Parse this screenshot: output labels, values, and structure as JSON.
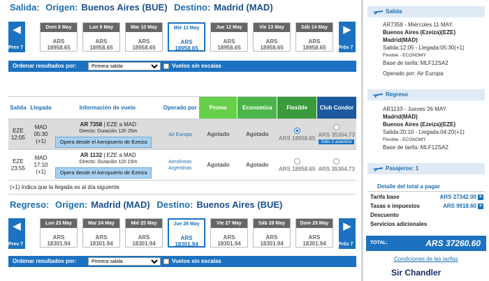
{
  "outbound": {
    "label": "Salida:",
    "origin_label": "Origen:",
    "origin": "Buenos Aires (BUE)",
    "dest_label": "Destino:",
    "dest": "Madrid (MAD)",
    "prev": "Prev 7",
    "next": "Próx 7",
    "days": [
      {
        "date": "Dom 8 May",
        "price": "ARS 18958.65"
      },
      {
        "date": "Lun 9 May",
        "price": "ARS 18958.65"
      },
      {
        "date": "Mar 10 May",
        "price": "ARS 18958.65"
      },
      {
        "date": "Mié 11 May",
        "price": "ARS 18958.65"
      },
      {
        "date": "Jue 12 May",
        "price": "ARS 18958.65"
      },
      {
        "date": "Vie 13 May",
        "price": "ARS 18958.65"
      },
      {
        "date": "Sáb 14 May",
        "price": "ARS 18958.65"
      }
    ],
    "order_label": "Ordenar resultados por:",
    "order_value": "Primera salida",
    "nonstop_label": "Vuelos sin escalas"
  },
  "table": {
    "headers": {
      "salida": "Salida",
      "llegada": "Llegada",
      "info": "Información de vuelo",
      "operado": "Operado por",
      "promo": "Promo",
      "economica": "Economica",
      "flexible": "Flexible",
      "club": "Club Condor"
    },
    "rows": [
      {
        "dep_code": "EZE",
        "dep_time": "12:05",
        "arr_code": "MAD",
        "arr_time": "05:30",
        "arr_next": "(+1)",
        "flight": "AR 7358",
        "route": "| EZE a MAD",
        "duration": "Directo: Duración 12h 25m",
        "note": "Opera desde el Aeropuerto de Ezeiza",
        "operator": "Air Europa",
        "promo": "Agotado",
        "econ": "Agotado",
        "flex": "ARS 18958.65",
        "club": "ARS 35304.73",
        "seats": "Sólo 2 asientos"
      },
      {
        "dep_code": "EZE",
        "dep_time": "23:55",
        "arr_code": "MAD",
        "arr_time": "17:10",
        "arr_next": "(+1)",
        "flight": "AR 1132",
        "route": "| EZE a MAD",
        "duration": "Directo: Duración 11h 15m",
        "note": "Opera desde el Aeropuerto de Ezeiza",
        "operator_1": "Aerolineas",
        "operator_2": "Argentinas",
        "promo": "Agotado",
        "econ": "Agotado",
        "flex": "ARS 18958.65",
        "club": "ARS 35304.73"
      }
    ],
    "footnote_mark": "(+1)",
    "footnote": "Indica que la llegada es al día siguiente"
  },
  "inbound": {
    "label": "Regreso:",
    "origin_label": "Origen:",
    "origin": "Madrid (MAD)",
    "dest_label": "Destino:",
    "dest": "Buenos Aires (BUE)",
    "prev": "Prev 7",
    "next": "Próx 7",
    "days": [
      {
        "date": "Lun 23 May",
        "price": "ARS 18301.94"
      },
      {
        "date": "Mar 24 May",
        "price": "ARS 18301.94"
      },
      {
        "date": "Mié 25 May",
        "price": "ARS 18301.94"
      },
      {
        "date": "Jue 26 May",
        "price": "ARS 18301.94"
      },
      {
        "date": "Vie 27 May",
        "price": "ARS 18301.94"
      },
      {
        "date": "Sáb 28 May",
        "price": "ARS 18301.94"
      },
      {
        "date": "Dom 29 May",
        "price": "ARS 18301.94"
      }
    ],
    "order_label": "Ordenar resultados por:",
    "order_value": "Primera salida",
    "nonstop_label": "Vuelos sin escalas"
  },
  "sidebar": {
    "outbound": {
      "title": "Salida",
      "line1": "AR7358 - Miércoles 11 MAY.",
      "from": "Buenos Aires (Ezeiza)(EZE)",
      "to": "Madrid(MAD)",
      "times": "Salida:12:05 - Llegada:05:30(+1)",
      "fare_class": "Flexible - ECONOMY",
      "fare_base": "Base de tarifa: MLF12SA2",
      "operator": "Operado por: Air Europa"
    },
    "inbound": {
      "title": "Regreso",
      "line1": "AR1133 - Jueves 26 MAY.",
      "from": "Madrid(MAD)",
      "to": "Buenos Aires (Ezeiza)(EZE)",
      "times": "Salida:20:10 - Llegada:04:20(+1)",
      "fare_class": "Flexible - ECONOMY",
      "fare_base": "Base de tarifa: MLF12SA2"
    },
    "passengers": "Pasajeros: 1",
    "detail_title": "Detalle del total a pagar",
    "fare_label": "Tarifa base",
    "fare_value": "ARS 27342.00",
    "tax_label": "Tasas e impuestos",
    "tax_value": "ARS 9918.60",
    "discount_label": "Descuento",
    "services_label": "Servicios adicionales",
    "total_label": "TOTAL:",
    "total_value": "ARS 37260.60",
    "conditions_link": "Condiciones de las tarifas"
  },
  "watermark": "Sir Chandler",
  "colors": {
    "brand_blue": "#1c72c0",
    "promo_green": "#67d04a",
    "econ_green": "#4cb54a",
    "flex_green": "#3a9a3c",
    "club_blue": "#1c5aa0"
  }
}
